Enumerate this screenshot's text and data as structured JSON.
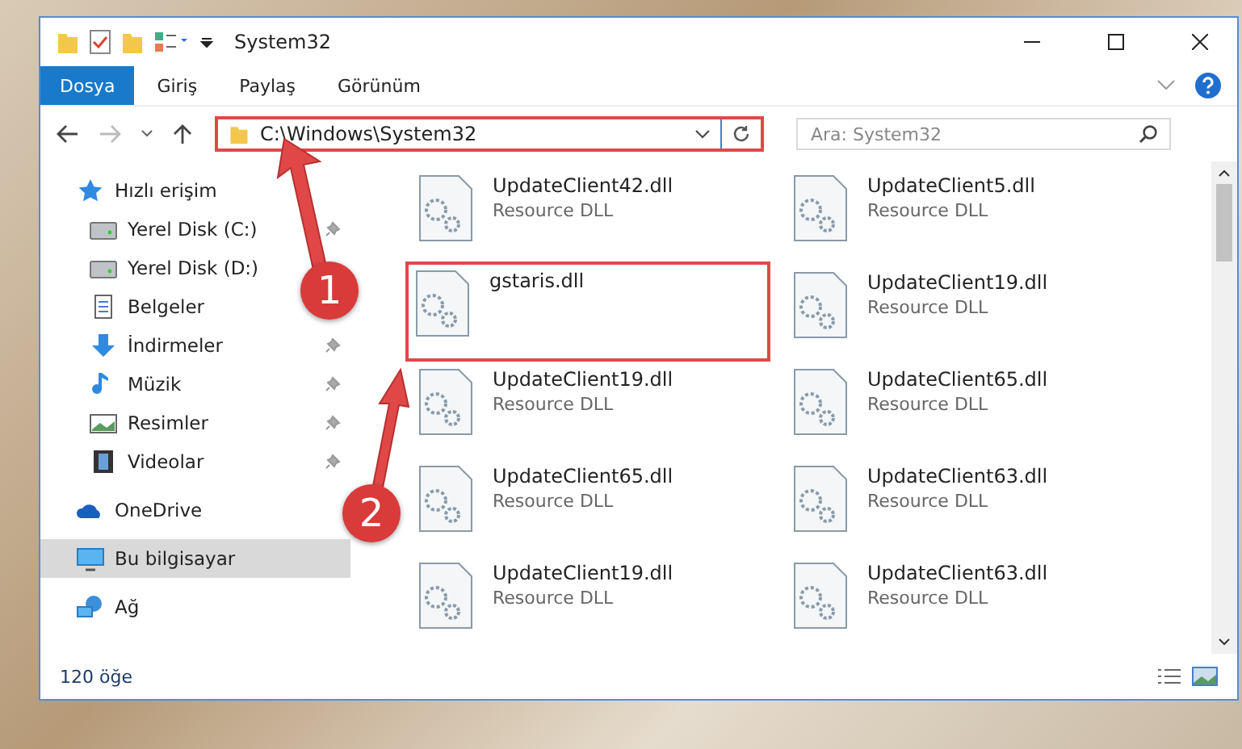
{
  "window": {
    "title": "System32"
  },
  "ribbon_tabs": [
    {
      "label": "Dosya",
      "selected": true
    },
    {
      "label": "Giriş",
      "selected": false
    },
    {
      "label": "Paylaş",
      "selected": false
    },
    {
      "label": "Görünüm",
      "selected": false
    }
  ],
  "address_bar": {
    "path": "C:\\Windows\\System32",
    "highlighted": true
  },
  "search": {
    "placeholder": "Ara: System32"
  },
  "sidebar": {
    "items": [
      {
        "label": "Hızlı erişim",
        "kind": "star",
        "pinned": false,
        "selected": false
      },
      {
        "label": "Yerel Disk (C:)",
        "kind": "drive",
        "pinned": true,
        "selected": false
      },
      {
        "label": "Yerel Disk (D:)",
        "kind": "drive",
        "pinned": false,
        "selected": false
      },
      {
        "label": "Belgeler",
        "kind": "document",
        "pinned": false,
        "selected": false
      },
      {
        "label": "İndirmeler",
        "kind": "download",
        "pinned": true,
        "selected": false
      },
      {
        "label": "Müzik",
        "kind": "music",
        "pinned": true,
        "selected": false
      },
      {
        "label": "Resimler",
        "kind": "picture",
        "pinned": true,
        "selected": false
      },
      {
        "label": "Videolar",
        "kind": "video",
        "pinned": true,
        "selected": false
      },
      {
        "label": "OneDrive",
        "kind": "cloud",
        "pinned": false,
        "selected": false
      },
      {
        "label": "Bu bilgisayar",
        "kind": "computer",
        "pinned": false,
        "selected": true
      },
      {
        "label": "Ağ",
        "kind": "network",
        "pinned": false,
        "selected": false
      }
    ]
  },
  "files": [
    {
      "name": "UpdateClient42.dll",
      "type": "Resource DLL",
      "highlighted": false
    },
    {
      "name": "UpdateClient5.dll",
      "type": "Resource DLL",
      "highlighted": false
    },
    {
      "name": "gstaris.dll",
      "highlighted": true
    },
    {
      "name": "UpdateClient19.dll",
      "type": "Resource DLL",
      "highlighted": false
    },
    {
      "name": "UpdateClient19.dll",
      "type": "Resource DLL",
      "highlighted": false
    },
    {
      "name": "UpdateClient65.dll",
      "type": "Resource DLL",
      "highlighted": false
    },
    {
      "name": "UpdateClient65.dll",
      "type": "Resource DLL",
      "highlighted": false
    },
    {
      "name": "UpdateClient63.dll",
      "type": "Resource DLL",
      "highlighted": false
    },
    {
      "name": "UpdateClient19.dll",
      "type": "Resource DLL",
      "highlighted": false
    },
    {
      "name": "UpdateClient63.dll",
      "type": "Resource DLL",
      "highlighted": false
    }
  ],
  "status_bar": {
    "count": "120 öğe"
  },
  "annotations": [
    {
      "number": "1"
    },
    {
      "number": "2"
    }
  ]
}
